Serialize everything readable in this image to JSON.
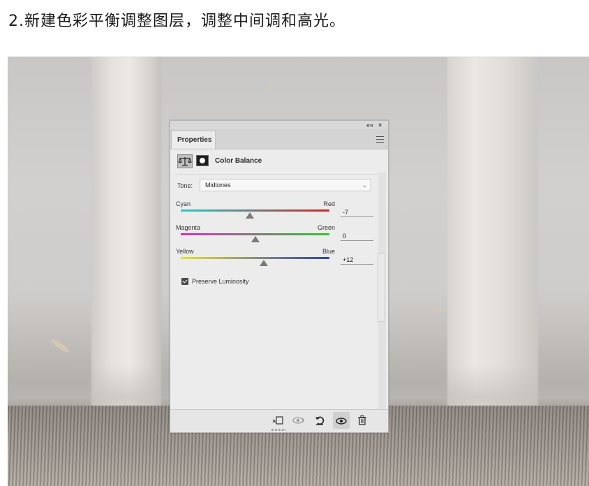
{
  "caption": "2.新建色彩平衡调整图层，调整中间调和高光。",
  "panel": {
    "collapse_icon": "««",
    "close_icon": "×",
    "tab_label": "Properties",
    "menu_icon": "panel-menu-icon",
    "adjustment_icon": "balance-scale-icon",
    "mask_icon": "layer-mask-icon",
    "title": "Color Balance",
    "tone_label": "Tone:",
    "tone_value": "Midtones",
    "sliders": [
      {
        "left": "Cyan",
        "right": "Red",
        "value": "-7",
        "level": -7,
        "gradient": [
          "#2fc6c7",
          "#c32a2a"
        ]
      },
      {
        "left": "Magenta",
        "right": "Green",
        "value": "0",
        "level": 0,
        "gradient": [
          "#d22fc4",
          "#2fc52f"
        ]
      },
      {
        "left": "Yellow",
        "right": "Blue",
        "value": "+12",
        "level": 12,
        "gradient": [
          "#e8e32a",
          "#2a3fc0"
        ]
      }
    ],
    "preserve_luminosity_label": "Preserve Luminosity",
    "preserve_luminosity_checked": true,
    "footer_icons": [
      "clip-to-layer-icon",
      "view-previous-icon",
      "reset-icon",
      "visibility-eye-icon",
      "trash-icon"
    ]
  }
}
